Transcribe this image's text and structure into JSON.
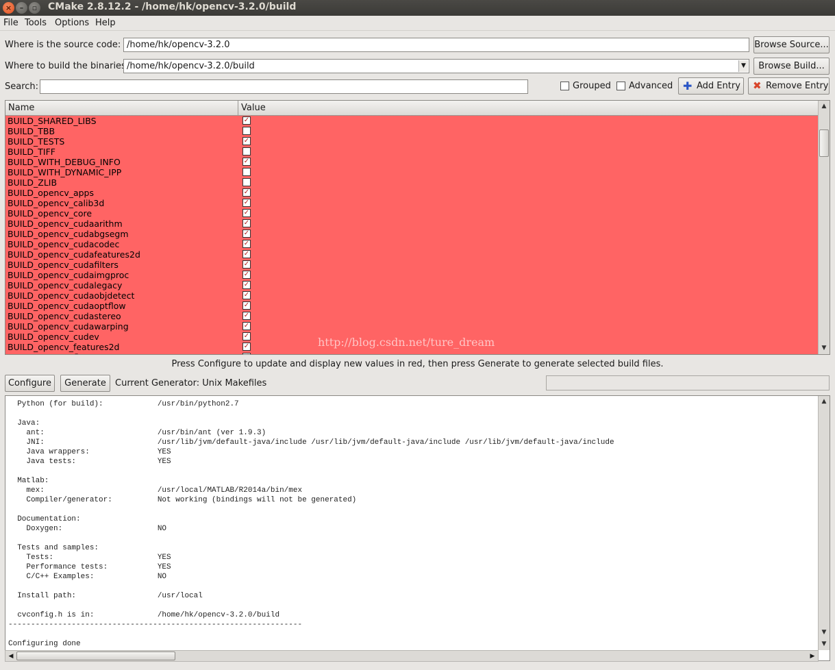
{
  "window": {
    "title": "CMake 2.8.12.2 - /home/hk/opencv-3.2.0/build"
  },
  "menu": {
    "file": "File",
    "tools": "Tools",
    "options": "Options",
    "help": "Help"
  },
  "source": {
    "label": "Where is the source code:",
    "value": "/home/hk/opencv-3.2.0",
    "browse": "Browse Source..."
  },
  "build": {
    "label": "Where to build the binaries:",
    "value": "/home/hk/opencv-3.2.0/build",
    "browse": "Browse Build..."
  },
  "search": {
    "label": "Search:",
    "value": ""
  },
  "options": {
    "grouped": "Grouped",
    "advanced": "Advanced",
    "add_entry": "Add Entry",
    "remove_entry": "Remove Entry"
  },
  "table": {
    "headers": {
      "name": "Name",
      "value": "Value"
    },
    "rows": [
      {
        "name": "BUILD_SHARED_LIBS",
        "checked": true
      },
      {
        "name": "BUILD_TBB",
        "checked": false
      },
      {
        "name": "BUILD_TESTS",
        "checked": true
      },
      {
        "name": "BUILD_TIFF",
        "checked": false
      },
      {
        "name": "BUILD_WITH_DEBUG_INFO",
        "checked": true
      },
      {
        "name": "BUILD_WITH_DYNAMIC_IPP",
        "checked": false
      },
      {
        "name": "BUILD_ZLIB",
        "checked": false
      },
      {
        "name": "BUILD_opencv_apps",
        "checked": true
      },
      {
        "name": "BUILD_opencv_calib3d",
        "checked": true
      },
      {
        "name": "BUILD_opencv_core",
        "checked": true
      },
      {
        "name": "BUILD_opencv_cudaarithm",
        "checked": true
      },
      {
        "name": "BUILD_opencv_cudabgsegm",
        "checked": true
      },
      {
        "name": "BUILD_opencv_cudacodec",
        "checked": true
      },
      {
        "name": "BUILD_opencv_cudafeatures2d",
        "checked": true
      },
      {
        "name": "BUILD_opencv_cudafilters",
        "checked": true
      },
      {
        "name": "BUILD_opencv_cudaimgproc",
        "checked": true
      },
      {
        "name": "BUILD_opencv_cudalegacy",
        "checked": true
      },
      {
        "name": "BUILD_opencv_cudaobjdetect",
        "checked": true
      },
      {
        "name": "BUILD_opencv_cudaoptflow",
        "checked": true
      },
      {
        "name": "BUILD_opencv_cudastereo",
        "checked": true
      },
      {
        "name": "BUILD_opencv_cudawarping",
        "checked": true
      },
      {
        "name": "BUILD_opencv_cudev",
        "checked": true
      },
      {
        "name": "BUILD_opencv_features2d",
        "checked": true
      },
      {
        "name": "BUILD_opencv_flann",
        "checked": true
      }
    ],
    "highlight_color": "#ff6464",
    "watermark": "http://blog.csdn.net/ture_dream"
  },
  "status_message": "Press Configure to update and display new values in red, then press Generate to generate selected build files.",
  "actions": {
    "configure": "Configure",
    "generate": "Generate",
    "generator": "Current Generator: Unix Makefiles"
  },
  "output": {
    "lines": [
      "  Python (for build):            /usr/bin/python2.7",
      "",
      "  Java:",
      "    ant:                         /usr/bin/ant (ver 1.9.3)",
      "    JNI:                         /usr/lib/jvm/default-java/include /usr/lib/jvm/default-java/include /usr/lib/jvm/default-java/include",
      "    Java wrappers:               YES",
      "    Java tests:                  YES",
      "",
      "  Matlab:",
      "    mex:                         /usr/local/MATLAB/R2014a/bin/mex",
      "    Compiler/generator:          Not working (bindings will not be generated)",
      "",
      "  Documentation:",
      "    Doxygen:                     NO",
      "",
      "  Tests and samples:",
      "    Tests:                       YES",
      "    Performance tests:           YES",
      "    C/C++ Examples:              NO",
      "",
      "  Install path:                  /usr/local",
      "",
      "  cvconfig.h is in:              /home/hk/opencv-3.2.0/build",
      "-----------------------------------------------------------------",
      "",
      "Configuring done"
    ]
  }
}
